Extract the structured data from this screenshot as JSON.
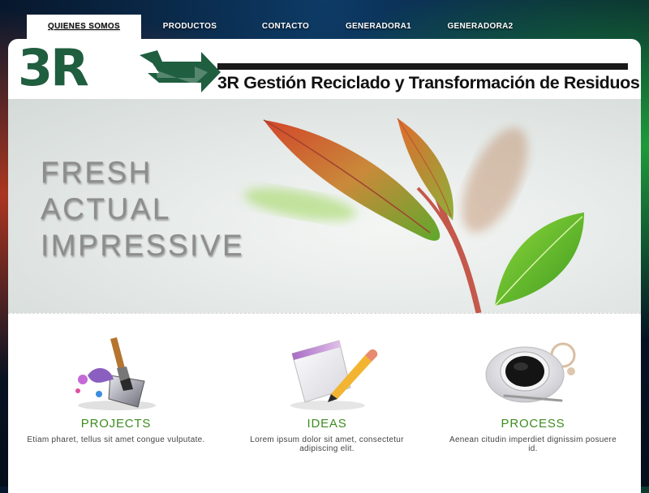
{
  "nav": {
    "items": [
      {
        "label": "QUIENES SOMOS",
        "active": true
      },
      {
        "label": "PRODUCTOS",
        "active": false
      },
      {
        "label": "CONTACTO",
        "active": false
      },
      {
        "label": "GENERADORA1",
        "active": false
      },
      {
        "label": "GENERADORA2",
        "active": false
      }
    ]
  },
  "header": {
    "logo_text": "3R",
    "company_name": "3R Gestión Reciclado y Transformación de Residuos",
    "brand_color": "#1f5e3f"
  },
  "hero": {
    "lines": [
      "FRESH",
      "ACTUAL",
      "IMPRESSIVE"
    ]
  },
  "features": [
    {
      "title": "PROJECTS",
      "text": "Etiam pharet, tellus sit amet congue vulputate.",
      "icon": "paint-bucket-icon"
    },
    {
      "title": "IDEAS",
      "text": "Lorem ipsum dolor sit amet, consectetur adipiscing elit.",
      "icon": "pencil-paper-icon"
    },
    {
      "title": "PROCESS",
      "text": "Aenean citudin imperdiet dignissim posuere id.",
      "icon": "coffee-cup-icon"
    }
  ],
  "colors": {
    "accent": "#3d8c1f"
  }
}
